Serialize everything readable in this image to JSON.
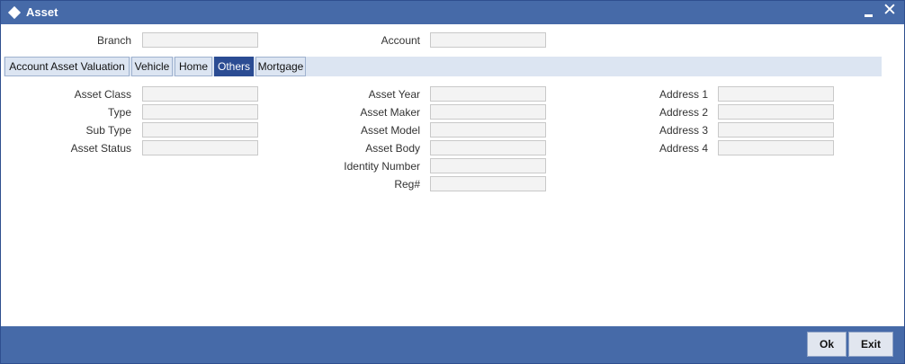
{
  "window": {
    "title": "Asset"
  },
  "header": {
    "branch_label": "Branch",
    "branch_value": "",
    "account_label": "Account",
    "account_value": ""
  },
  "tabs": [
    {
      "label": "Account Asset Valuation"
    },
    {
      "label": "Vehicle"
    },
    {
      "label": "Home"
    },
    {
      "label": "Others",
      "active": true
    },
    {
      "label": "Mortgage"
    }
  ],
  "others": {
    "asset_class_label": "Asset Class",
    "type_label": "Type",
    "sub_type_label": "Sub Type",
    "asset_status_label": "Asset Status",
    "asset_year_label": "Asset Year",
    "asset_maker_label": "Asset Maker",
    "asset_model_label": "Asset Model",
    "asset_body_label": "Asset Body",
    "identity_number_label": "Identity Number",
    "reg_label": "Reg#",
    "address1_label": "Address 1",
    "address2_label": "Address 2",
    "address3_label": "Address 3",
    "address4_label": "Address 4"
  },
  "footer": {
    "ok_label": "Ok",
    "exit_label": "Exit"
  },
  "colors": {
    "titlebar": "#466aa8",
    "active_tab": "#2b4c93",
    "tab_strip": "#dce5f2"
  }
}
